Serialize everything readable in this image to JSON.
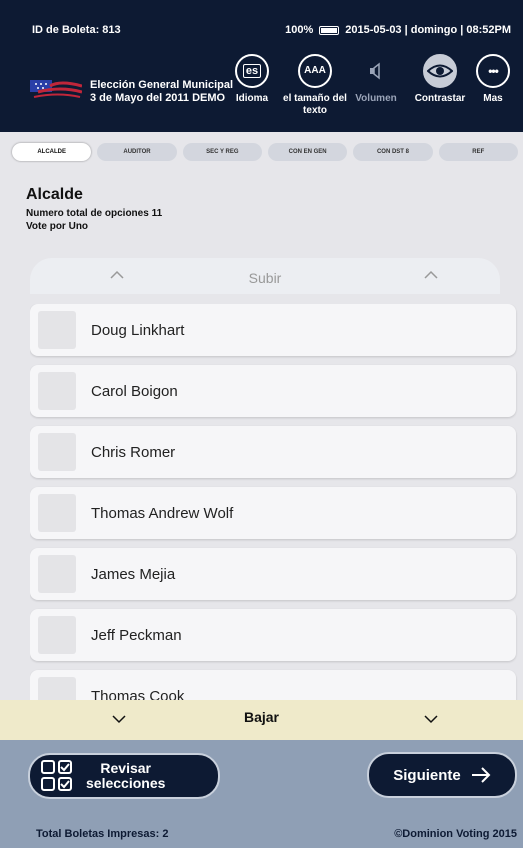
{
  "statusbar": {
    "ballot_id": "ID de Boleta: 813",
    "battery": "100%",
    "datetime": "2015-05-03 | domingo | 08:52PM"
  },
  "header": {
    "election_line1": "Elección General Municipal",
    "election_line2": "3 de Mayo del 2011 DEMO",
    "buttons": {
      "language": {
        "label": "Idioma",
        "glyph": "es"
      },
      "text_size": {
        "label": "el tamaño del texto",
        "glyph": "AAA"
      },
      "volume": {
        "label": "Volumen"
      },
      "contrast": {
        "label": "Contrastar"
      },
      "more": {
        "label": "Mas",
        "glyph": "•••"
      }
    }
  },
  "tabs": [
    "ALCALDE",
    "AUDITOR",
    "SEC Y REG",
    "CON EN GEN",
    "CON DST 8",
    "REF"
  ],
  "contest": {
    "title": "Alcalde",
    "total_options": "Numero total de opciones 11",
    "vote_for": "Vote por Uno"
  },
  "scroll_up_label": "Subir",
  "scroll_down_label": "Bajar",
  "candidates": [
    "Doug Linkhart",
    "Carol Boigon",
    "Chris Romer",
    "Thomas Andrew Wolf",
    "James Mejia",
    "Jeff Peckman",
    "Thomas Cook"
  ],
  "footer": {
    "review_line1": "Revisar",
    "review_line2": "selecciones",
    "next_label": "Siguiente",
    "total_printed": "Total Boletas Impresas: 2",
    "copyright": "©Dominion Voting 2015"
  },
  "colors": {
    "navy": "#0d1a33",
    "footer": "#8f9fb5",
    "scroll_down": "#efeaca"
  }
}
